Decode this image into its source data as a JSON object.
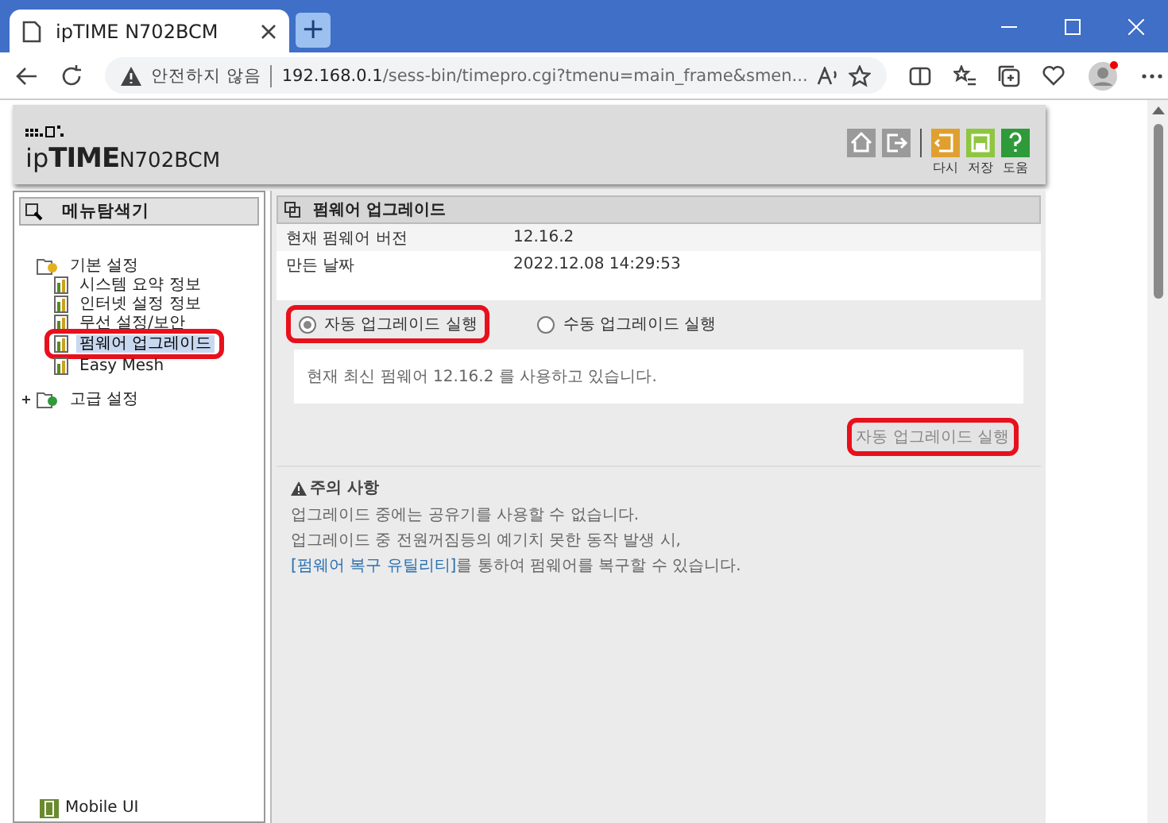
{
  "browser": {
    "tab_title": "ipTIME N702BCM",
    "new_tab": "+",
    "security_label": "안전하지 않음",
    "url_host": "192.168.0.1",
    "url_path": "/sess-bin/timepro.cgi?tmenu=main_frame&smen..."
  },
  "header": {
    "logo_prefix": "ip",
    "logo_main": "TIME",
    "model": "N702BCM",
    "toolbar": [
      {
        "kind": "home"
      },
      {
        "kind": "logout"
      },
      {
        "kind": "refresh",
        "label": "다시"
      },
      {
        "kind": "save",
        "label": "저장"
      },
      {
        "kind": "help",
        "label": "도움"
      }
    ]
  },
  "sidebar": {
    "title": "메뉴탐색기",
    "tree": [
      {
        "label": "기본 설정",
        "expanded": true,
        "children": [
          {
            "label": "시스템 요약 정보",
            "selected": false,
            "highlighted": false
          },
          {
            "label": "인터넷 설정 정보",
            "selected": false,
            "highlighted": false
          },
          {
            "label": "무선 설정/보안",
            "selected": false,
            "highlighted": false
          },
          {
            "label": "펌웨어 업그레이드",
            "selected": true,
            "highlighted": true
          },
          {
            "label": "Easy Mesh",
            "selected": false,
            "highlighted": false
          }
        ]
      },
      {
        "label": "고급 설정",
        "expanded": false
      }
    ],
    "footer": "Mobile UI"
  },
  "main": {
    "title": "펌웨어 업그레이드",
    "info": [
      {
        "label": "현재 펌웨어 버전",
        "value": "12.16.2"
      },
      {
        "label": "만든 날짜",
        "value": "2022.12.08 14:29:53"
      }
    ],
    "modes": [
      {
        "label": "자동 업그레이드 실행",
        "selected": true,
        "highlighted": true
      },
      {
        "label": "수동 업그레이드 실행",
        "selected": false,
        "highlighted": false
      }
    ],
    "message": "현재 최신 펌웨어 12.16.2 를 사용하고 있습니다.",
    "action": {
      "label": "자동 업그레이드 실행",
      "disabled": true,
      "highlighted": true
    },
    "notice": {
      "title": "주의 사항",
      "lines": [
        "업그레이드 중에는 공유기를 사용할 수 없습니다.",
        "업그레이드 중 전원꺼짐등의 예기치 못한 동작 발생 시,"
      ],
      "link": "[펌웨어 복구 유틸리티]",
      "link_tail": "를 통하여 펌웨어를 복구할 수 있습니다."
    }
  }
}
